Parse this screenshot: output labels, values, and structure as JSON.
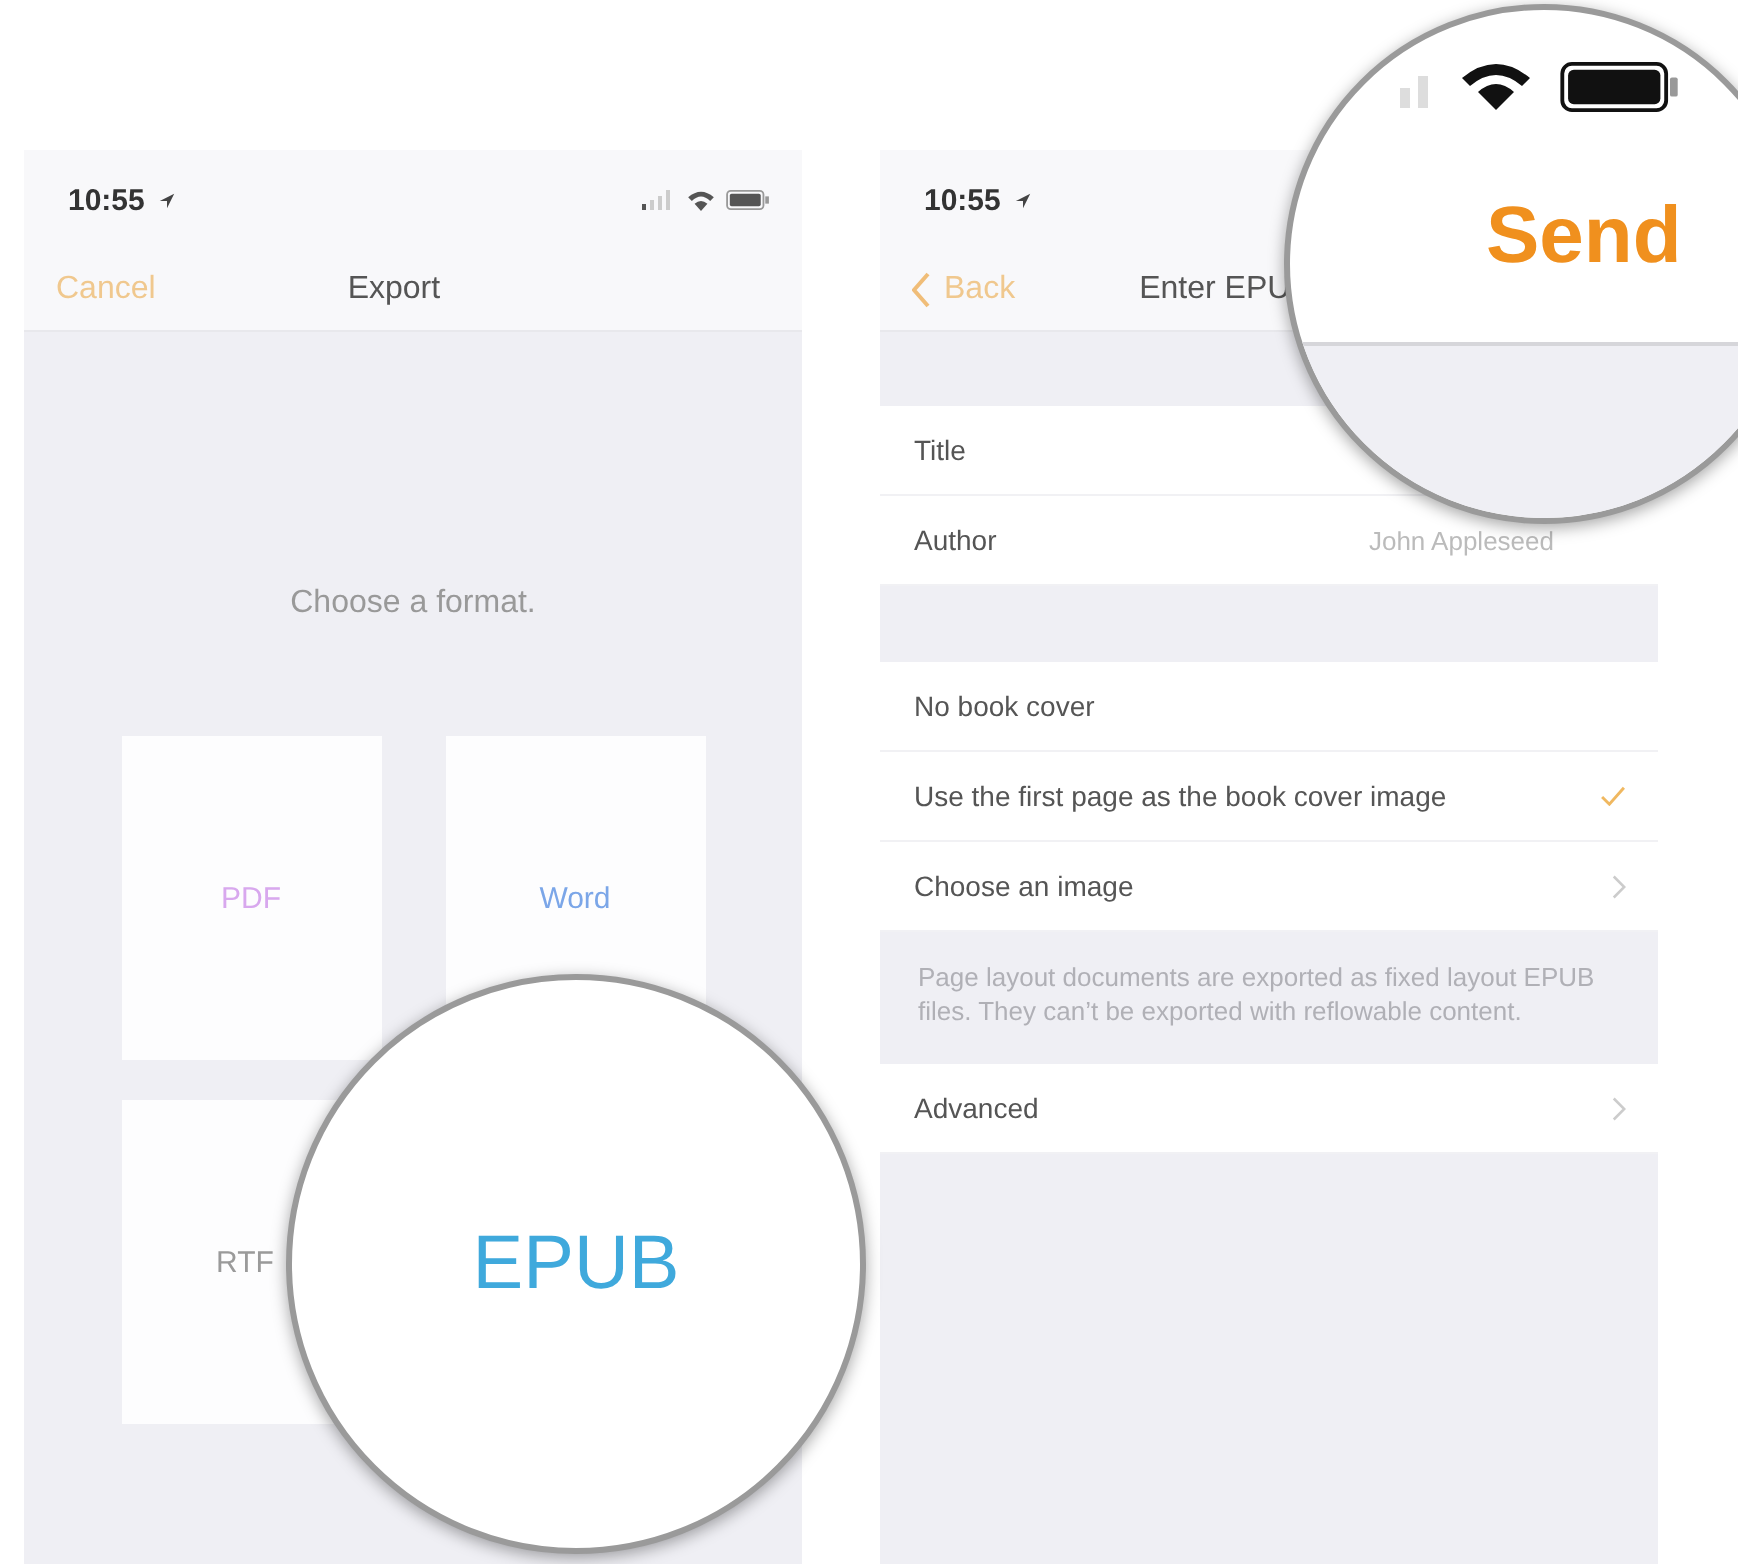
{
  "left_screen": {
    "status_bar": {
      "time": "10:55"
    },
    "nav_bar": {
      "cancel_button": "Cancel",
      "title": "Export"
    },
    "prompt": "Choose a format.",
    "formats": [
      {
        "label": "PDF",
        "color": "#d8a8ee"
      },
      {
        "label": "Word",
        "color": "#7ba6e8"
      },
      {
        "label": "RTF",
        "color": "#9a9a9a"
      }
    ]
  },
  "left_magnifier": {
    "label": "EPUB"
  },
  "right_screen": {
    "status_bar": {
      "time": "10:55"
    },
    "nav_bar": {
      "back_button": "Back",
      "title": "Enter EPU"
    },
    "info_rows": [
      {
        "label": "Title"
      },
      {
        "label": "Author",
        "value": "John Appleseed"
      }
    ],
    "cover_options": [
      {
        "label": "No book cover",
        "kind": "option",
        "selected": false
      },
      {
        "label": "Use the first page as the book cover image",
        "kind": "option",
        "selected": true
      },
      {
        "label": "Choose an image",
        "kind": "link"
      }
    ],
    "footer": "Page layout documents are exported as fixed layout EPUB files. They can’t be exported with reflowable content.",
    "advanced": {
      "label": "Advanced"
    }
  },
  "right_magnifier": {
    "send_button": "Send"
  }
}
